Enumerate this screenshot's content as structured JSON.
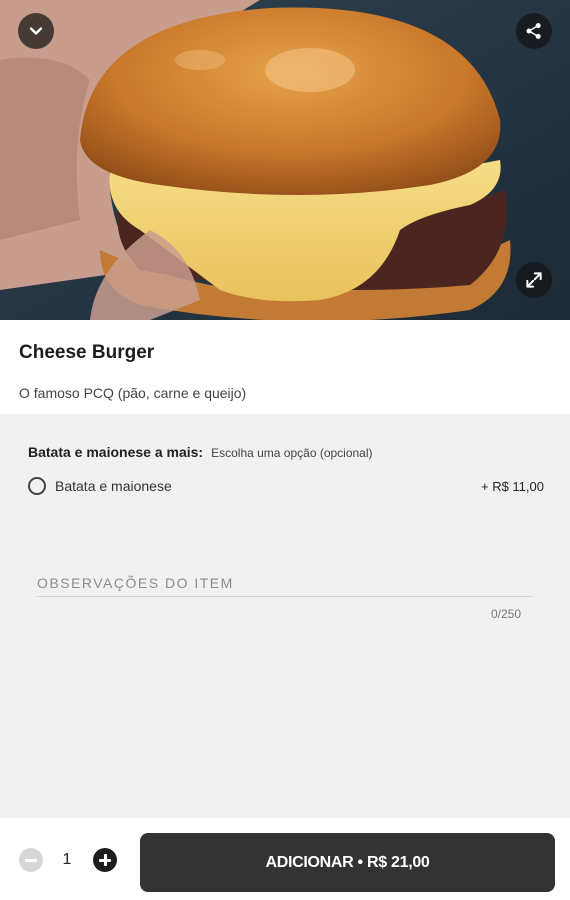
{
  "product": {
    "title": "Cheese Burger",
    "description": "O famoso PCQ (pão, carne e queijo)"
  },
  "hero": {
    "collapse_icon": "chevron-down-icon",
    "share_icon": "share-icon",
    "expand_icon": "expand-icon"
  },
  "option_group": {
    "title": "Batata e maionese a mais:",
    "subtitle": "Escolha uma opção (opcional)",
    "options": [
      {
        "label": "Batata e maionese",
        "price": "+ R$ 11,00",
        "selected": false
      }
    ]
  },
  "notes": {
    "placeholder": "OBSERVAÇÕES DO ITEM",
    "counter": "0/250"
  },
  "footer": {
    "quantity": "1",
    "add_button_label": "ADICIONAR • R$ 21,00"
  },
  "colors": {
    "button_dark": "#333333",
    "background": "#f1f1f1",
    "white": "#ffffff"
  }
}
